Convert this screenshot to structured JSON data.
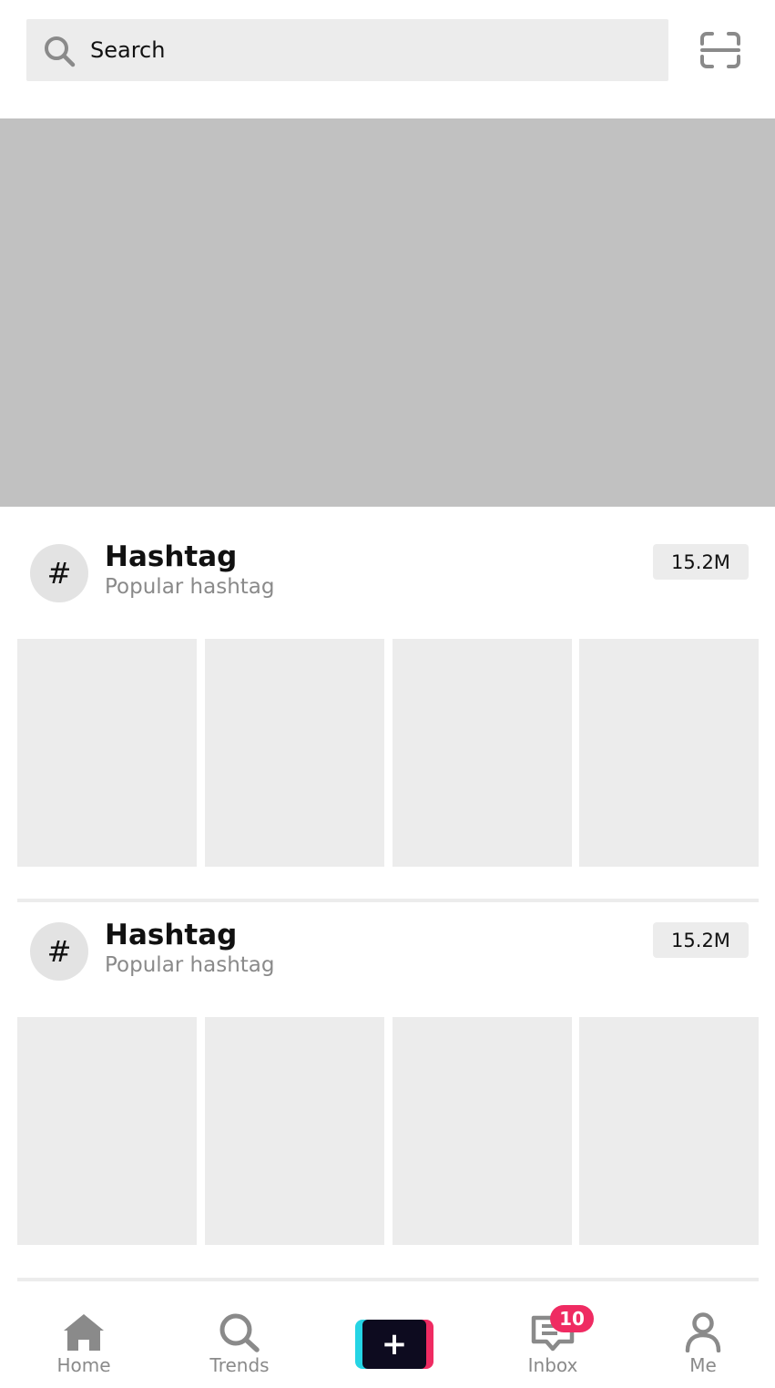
{
  "search": {
    "placeholder": "Search",
    "icon": "search-icon",
    "scan_icon": "scan-icon"
  },
  "banner": {
    "color": "#c1c1c1"
  },
  "sections": [
    {
      "icon_symbol": "#",
      "title": "Hashtag",
      "subtitle": "Popular hashtag",
      "count": "15.2M",
      "thumbnails": 4
    },
    {
      "icon_symbol": "#",
      "title": "Hashtag",
      "subtitle": "Popular hashtag",
      "count": "15.2M",
      "thumbnails": 4
    }
  ],
  "bottom_nav": {
    "items": [
      {
        "label": "Home",
        "icon": "home-icon"
      },
      {
        "label": "Trends",
        "icon": "search-icon"
      },
      {
        "label": "+",
        "icon": "plus-icon"
      },
      {
        "label": "Inbox",
        "icon": "inbox-icon",
        "badge": "10"
      },
      {
        "label": "Me",
        "icon": "profile-icon"
      }
    ]
  },
  "colors": {
    "accent_pink": "#ef2b62",
    "accent_cyan": "#25d4e4",
    "create_dark": "#0d0b1f",
    "placeholder_gray": "#ececec",
    "text_muted": "#8a8a8a"
  }
}
